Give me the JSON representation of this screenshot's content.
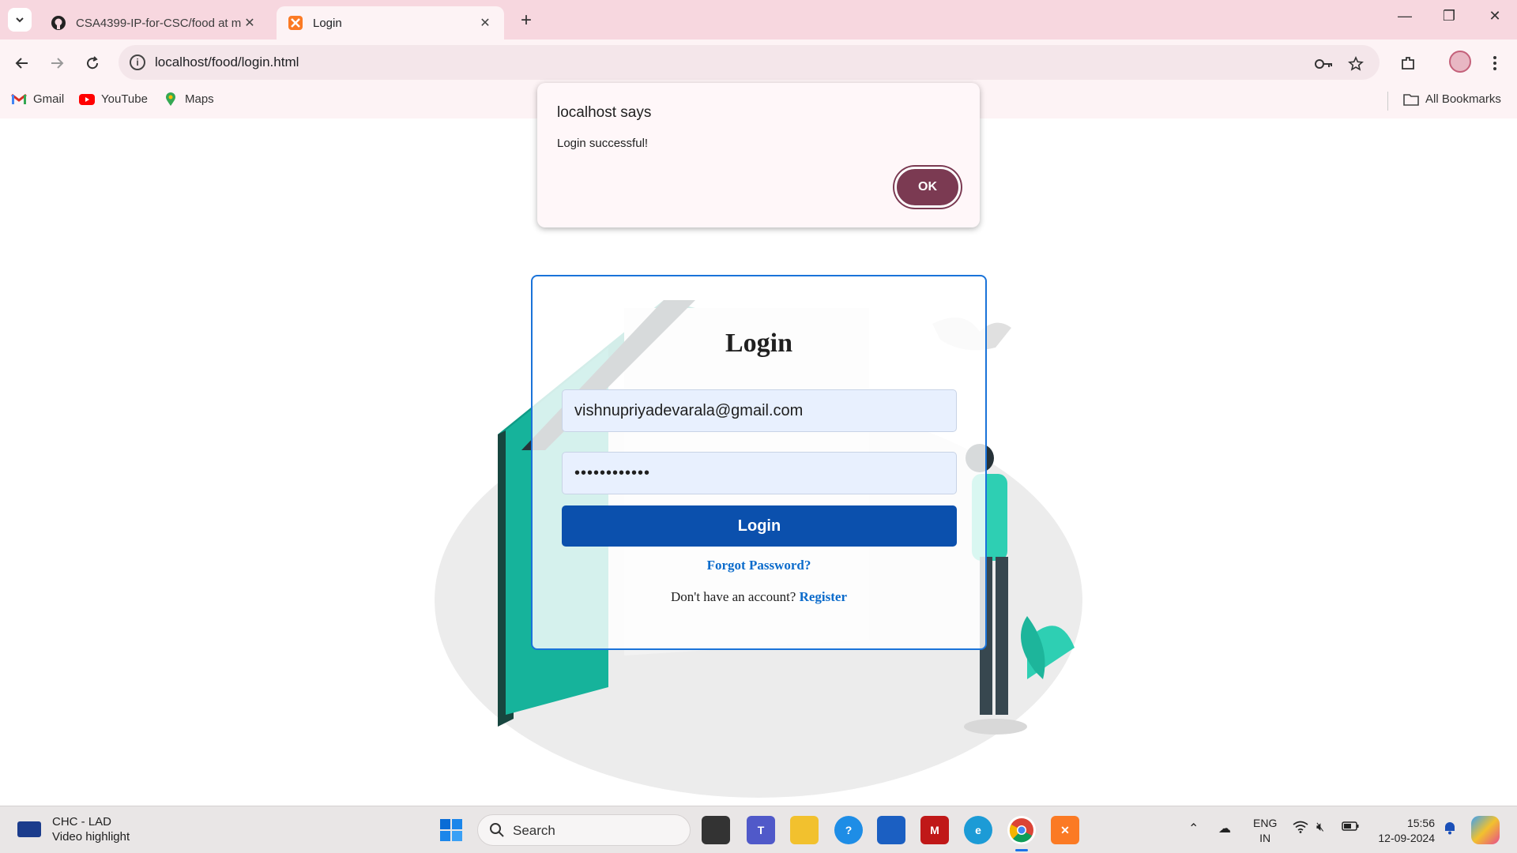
{
  "browser": {
    "tabs": [
      {
        "title": "CSA4399-IP-for-CSC/food at m",
        "active": false
      },
      {
        "title": "Login",
        "active": true
      }
    ],
    "url": "localhost/food/login.html",
    "bookmarks": [
      "Gmail",
      "YouTube",
      "Maps"
    ],
    "all_bookmarks_label": "All Bookmarks"
  },
  "dialog": {
    "title": "localhost says",
    "message": "Login successful!",
    "ok_label": "OK"
  },
  "login_form": {
    "heading": "Login",
    "email_value": "vishnupriyadevarala@gmail.com",
    "password_mask": "••••••••••••",
    "submit_label": "Login",
    "forgot_label": "Forgot Password?",
    "no_account_text": "Don't have an account?",
    "register_label": "Register",
    "accent_color": "#0b50ad"
  },
  "taskbar": {
    "weather_title": "CHC - LAD",
    "weather_subtitle": "Video highlight",
    "search_label": "Search",
    "lang_top": "ENG",
    "lang_bottom": "IN",
    "time": "15:56",
    "date": "12-09-2024"
  }
}
